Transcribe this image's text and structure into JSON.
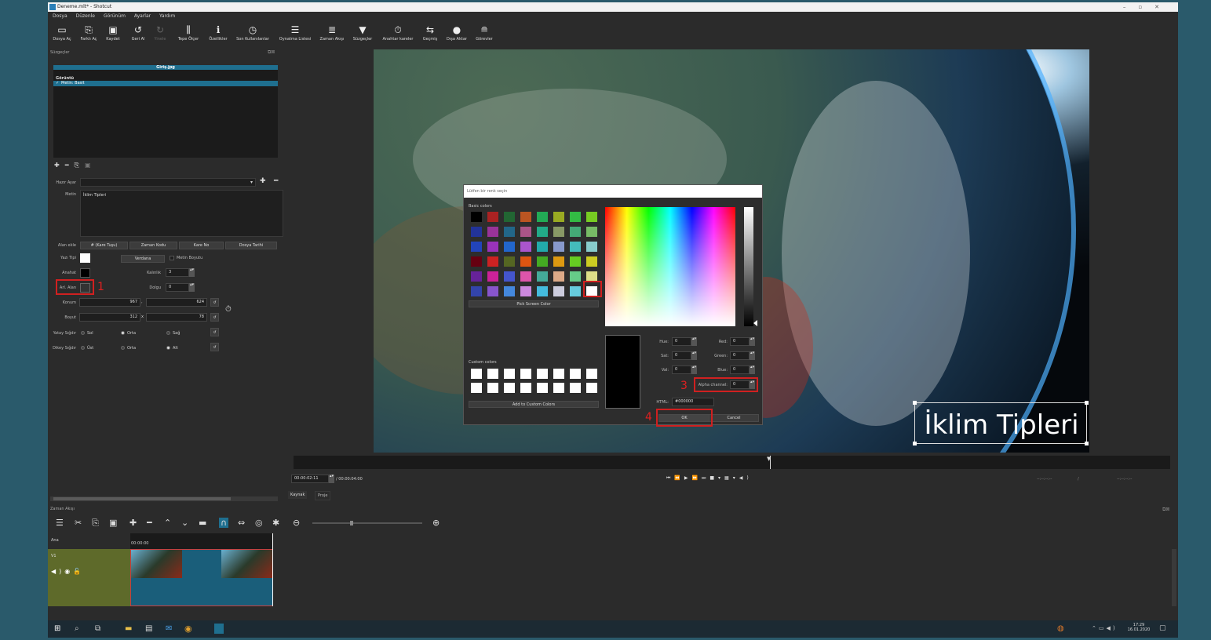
{
  "window": {
    "title": "Deneme.mlt* - Shotcut"
  },
  "menu": [
    "Dosya",
    "Düzenle",
    "Görünüm",
    "Ayarlar",
    "Yardım"
  ],
  "toolbar": [
    {
      "label": "Dosya Aç",
      "icon": "folder-open-icon",
      "enabled": true
    },
    {
      "label": "Farklı Aç",
      "icon": "open-other-icon",
      "enabled": true
    },
    {
      "label": "Kaydet",
      "icon": "save-icon",
      "enabled": true
    },
    {
      "label": "Geri Al",
      "icon": "undo-icon",
      "enabled": true
    },
    {
      "label": "Yinele",
      "icon": "redo-icon",
      "enabled": false
    },
    {
      "label": "Tepe Ölçer",
      "icon": "peak-meter-icon",
      "enabled": true
    },
    {
      "label": "Özellikler",
      "icon": "info-icon",
      "enabled": true
    },
    {
      "label": "Son Kullanılanlar",
      "icon": "recent-icon",
      "enabled": true
    },
    {
      "label": "Oynatma Listesi",
      "icon": "playlist-icon",
      "enabled": true
    },
    {
      "label": "Zaman Akışı",
      "icon": "timeline-icon",
      "enabled": true
    },
    {
      "label": "Süzgeçler",
      "icon": "filter-icon",
      "enabled": true
    },
    {
      "label": "Anahtar kareler",
      "icon": "keyframes-icon",
      "enabled": true
    },
    {
      "label": "Geçmiş",
      "icon": "history-icon",
      "enabled": true
    },
    {
      "label": "Dışa Aktar",
      "icon": "export-icon",
      "enabled": true
    },
    {
      "label": "Görevler",
      "icon": "jobs-icon",
      "enabled": true
    }
  ],
  "filters_panel": {
    "title": "Süzgeçler",
    "clip_name": "Giriş.jpg",
    "category": "Görüntü",
    "filter_item": "Metin: Basit",
    "preset_label": "Hazır Ayar",
    "text_label": "Metin",
    "text_value": "İklim Tipleri",
    "insert_field_label": "Alan ekle",
    "insert_buttons": [
      "# (Kare Tuşu)",
      "Zaman Kodu",
      "Kare No",
      "Dosya Tarihi"
    ],
    "font_label": "Yazı Tipi",
    "font_button": "Verdana",
    "font_size_checkbox": "Metin Boyutu",
    "outline_label": "Anahat",
    "thickness_label": "Kalınlık",
    "thickness_value": "3",
    "background_label": "Arl. Alan",
    "padding_label": "Dolgu",
    "padding_value": "0",
    "position_label": "Konum",
    "position_x": "967",
    "position_y": "624",
    "size_label": "Boyut",
    "size_w": "312",
    "size_h": "78",
    "halign_label": "Yatay Sığdır",
    "halign_options": [
      "Sol",
      "Orta",
      "Sağ"
    ],
    "halign_selected": "Orta",
    "valign_label": "Dikey Sığdır",
    "valign_options": [
      "Üst",
      "Orta",
      "Alt"
    ],
    "valign_selected": "Alt",
    "tabs": [
      "Kaynak",
      "Proje"
    ],
    "sep_x": "x",
    "sep_comma": ","
  },
  "annotations": [
    "1",
    "2",
    "3",
    "4"
  ],
  "color_dialog": {
    "title": "Lütfen bir renk seçin",
    "basic_colors_label": "Basic colors",
    "pick_screen_label": "Pick Screen Color",
    "custom_colors_label": "Custom colors",
    "add_custom_label": "Add to Custom Colors",
    "hue_label": "Hue:",
    "hue_value": "0",
    "sat_label": "Sat:",
    "sat_value": "0",
    "val_label": "Val:",
    "val_value": "0",
    "red_label": "Red:",
    "red_value": "0",
    "green_label": "Green:",
    "green_value": "0",
    "blue_label": "Blue:",
    "blue_value": "0",
    "alpha_label": "Alpha channel:",
    "alpha_value": "0",
    "html_label": "HTML:",
    "html_value": "#000000",
    "ok_label": "OK",
    "cancel_label": "Cancel",
    "basic_colors": [
      "#000000",
      "#aa2222",
      "#226633",
      "#bb5522",
      "#22aa55",
      "#99aa22",
      "#33bb44",
      "#77cc22",
      "#223399",
      "#993399",
      "#226688",
      "#aa5588",
      "#22aa88",
      "#889966",
      "#44aa77",
      "#77bb66",
      "#2244bb",
      "#9933bb",
      "#2266cc",
      "#aa55cc",
      "#22aaaa",
      "#8899cc",
      "#44bbbb",
      "#88cccc",
      "#660011",
      "#cc2222",
      "#556622",
      "#dd5511",
      "#44aa22",
      "#dd9911",
      "#66cc22",
      "#cccc22",
      "#662299",
      "#cc2299",
      "#4455cc",
      "#dd55aa",
      "#44aa99",
      "#ddaa88",
      "#66cc88",
      "#dddd88",
      "#3344aa",
      "#8855cc",
      "#4488dd",
      "#cc88dd",
      "#44bbdd",
      "#ccccdd",
      "#66ccdd",
      "#ffffff"
    ]
  },
  "player": {
    "overlay_text": "İklim Tipleri",
    "timecode": "00:00:02:11",
    "duration": "/ 00:00:04:00",
    "in_point": "--:--:--:--",
    "out_point": "--:--:--:--",
    "in_sep": "/"
  },
  "timeline": {
    "title": "Zaman Akışı",
    "master_label": "Ana",
    "track_label": "V1",
    "ruler_start": "00:00:00"
  },
  "taskbar": {
    "time": "17:29",
    "date": "16.01.2020"
  }
}
